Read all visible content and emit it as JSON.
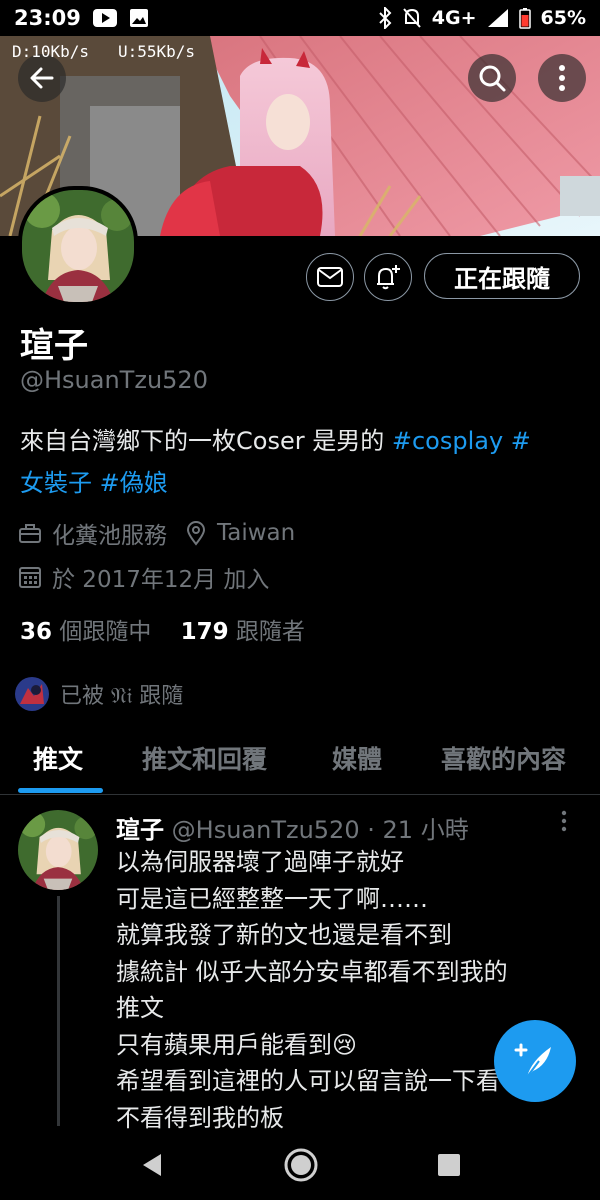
{
  "status_bar": {
    "time": "23:09",
    "network": "4G+",
    "battery": "65%",
    "download_speed": "D:10Kb/s",
    "upload_speed": "U:55Kb/s"
  },
  "profile": {
    "display_name": "瑄子",
    "handle": "@HsuanTzu520",
    "bio_text": "來自台灣鄉下的一枚Coser 是男的 ",
    "bio_tag_1": "#cosplay",
    "bio_tag_2_part1": "#",
    "bio_tag_2_part2": "女裝子",
    "bio_tag_3": "#偽娘",
    "category": "化糞池服務",
    "location": "Taiwan",
    "joined": "於 2017年12月 加入",
    "following_count": "36",
    "following_label": "個跟隨中",
    "followers_count": "179",
    "followers_label": "跟隨者",
    "followed_by_label": "已被 𝔑𝔦 跟隨",
    "follow_button_label": "正在跟隨"
  },
  "tabs": [
    {
      "label": "推文",
      "active": true
    },
    {
      "label": "推文和回覆",
      "active": false
    },
    {
      "label": "媒體",
      "active": false
    },
    {
      "label": "喜歡的內容",
      "active": false
    }
  ],
  "tweet": {
    "name": "瑄子",
    "handle": "@HsuanTzu520",
    "separator": "·",
    "time": "21 小時",
    "lines": [
      "以為伺服器壞了過陣子就好",
      "可是這已經整整一天了啊……",
      "就算我發了新的文也還是看不到",
      "據統計 似乎大部分安卓都看不到我的",
      "推文",
      "只有蘋果用戶能看到😢",
      "希望看到這裡的人可以留言說一下看",
      "不看得到我的板"
    ]
  },
  "colors": {
    "accent": "#1d9bf0",
    "background": "#000000",
    "secondary_text": "#71767b"
  },
  "icons": {
    "back": "arrow-left-icon",
    "search": "search-icon",
    "more": "more-vertical-icon",
    "message": "mail-icon",
    "notify": "bell-plus-icon",
    "compose": "feather-plus-icon"
  }
}
